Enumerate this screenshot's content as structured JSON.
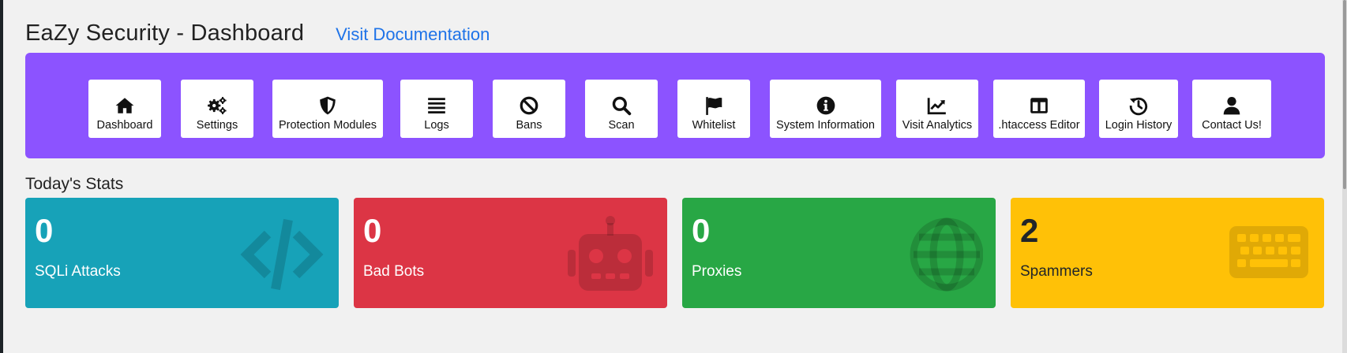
{
  "header": {
    "title": "EaZy Security - Dashboard",
    "doc_link": "Visit Documentation"
  },
  "nav": {
    "items": [
      {
        "label": "Dashboard",
        "icon": "home-icon"
      },
      {
        "label": "Settings",
        "icon": "cogs-icon"
      },
      {
        "label": "Protection Modules",
        "icon": "shield-icon"
      },
      {
        "label": "Logs",
        "icon": "list-icon"
      },
      {
        "label": "Bans",
        "icon": "ban-icon"
      },
      {
        "label": "Scan",
        "icon": "search-icon"
      },
      {
        "label": "Whitelist",
        "icon": "flag-icon"
      },
      {
        "label": "System Information",
        "icon": "info-circle-icon"
      },
      {
        "label": "Visit Analytics",
        "icon": "chart-line-icon"
      },
      {
        "label": ".htaccess Editor",
        "icon": "columns-icon"
      },
      {
        "label": "Login History",
        "icon": "history-icon"
      },
      {
        "label": "Contact Us!",
        "icon": "user-icon"
      }
    ],
    "bg_color": "#8c53ff"
  },
  "stats": {
    "title": "Today's Stats",
    "cards": [
      {
        "value": "0",
        "label": "SQLi Attacks",
        "color": "#17a2b8",
        "icon": "code-icon"
      },
      {
        "value": "0",
        "label": "Bad Bots",
        "color": "#dc3545",
        "icon": "robot-icon"
      },
      {
        "value": "0",
        "label": "Proxies",
        "color": "#28a745",
        "icon": "globe-icon"
      },
      {
        "value": "2",
        "label": "Spammers",
        "color": "#ffc107",
        "icon": "keyboard-icon"
      }
    ]
  }
}
